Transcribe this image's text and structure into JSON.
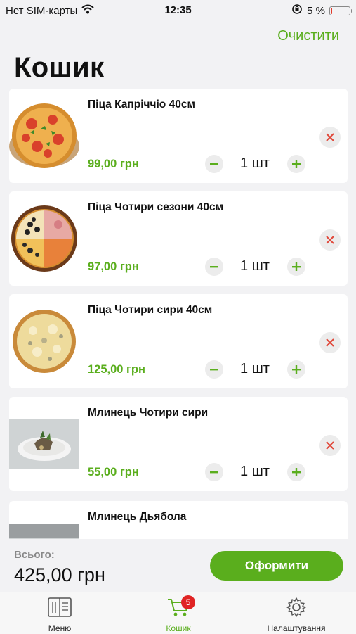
{
  "status_bar": {
    "carrier": "Нет SIM-карты",
    "time": "12:35",
    "battery": "5 %",
    "battery_level": 0.05
  },
  "header": {
    "clear_label": "Очистити",
    "title": "Кошик"
  },
  "items": [
    {
      "name": "Піца Капріччіо 40см",
      "price": "99,00 грн",
      "quantity": "1 шт",
      "image": "pizza-capricciosa"
    },
    {
      "name": "Піца Чотири сезони 40см",
      "price": "97,00 грн",
      "quantity": "1 шт",
      "image": "pizza-four-seasons"
    },
    {
      "name": "Піца Чотири сири 40см",
      "price": "125,00 грн",
      "quantity": "1 шт",
      "image": "pizza-four-cheese"
    },
    {
      "name": "Млинець Чотири сири",
      "price": "55,00 грн",
      "quantity": "1 шт",
      "image": "pancake-four-cheese"
    },
    {
      "name": "Млинець Дьябола",
      "price": "",
      "quantity": "",
      "image": "pancake-diabola"
    }
  ],
  "footer": {
    "total_label": "Всього:",
    "total_value": "425,00 грн",
    "checkout_label": "Оформити"
  },
  "tabs": [
    {
      "label": "Меню",
      "icon": "menu-book-icon"
    },
    {
      "label": "Кошик",
      "icon": "cart-icon",
      "badge": "5",
      "active": true
    },
    {
      "label": "Налаштування",
      "icon": "gear-icon"
    }
  ],
  "colors": {
    "accent": "#5aae1d",
    "badge": "#e02424",
    "remove": "#e0483a",
    "background": "#f2f2f4"
  }
}
